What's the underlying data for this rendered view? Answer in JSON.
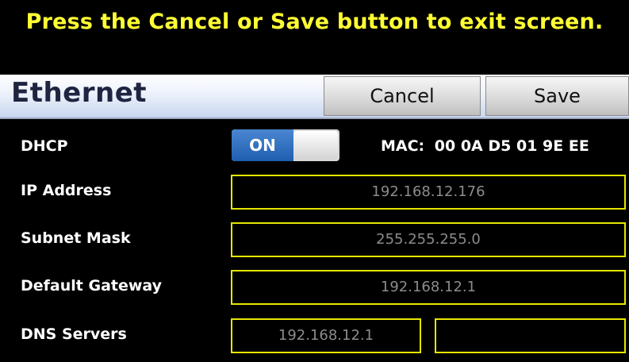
{
  "banner": {
    "text": "Press the Cancel or Save button to exit screen."
  },
  "header": {
    "title": "Ethernet",
    "cancel_label": "Cancel",
    "save_label": "Save"
  },
  "dhcp": {
    "label": "DHCP",
    "toggle_text": "ON",
    "mac_label": "MAC:",
    "mac_value": "00 0A D5 01 9E EE"
  },
  "ip": {
    "label": "IP Address",
    "value": "192.168.12.176"
  },
  "subnet": {
    "label": "Subnet Mask",
    "value": "255.255.255.0"
  },
  "gateway": {
    "label": "Default Gateway",
    "value": "192.168.12.1"
  },
  "dns": {
    "label": "DNS Servers",
    "primary": "192.168.12.1",
    "secondary": ""
  },
  "colors": {
    "highlight": "#ffff33",
    "field_border": "#e6e600",
    "toggle_on": "#2f6fc0"
  }
}
